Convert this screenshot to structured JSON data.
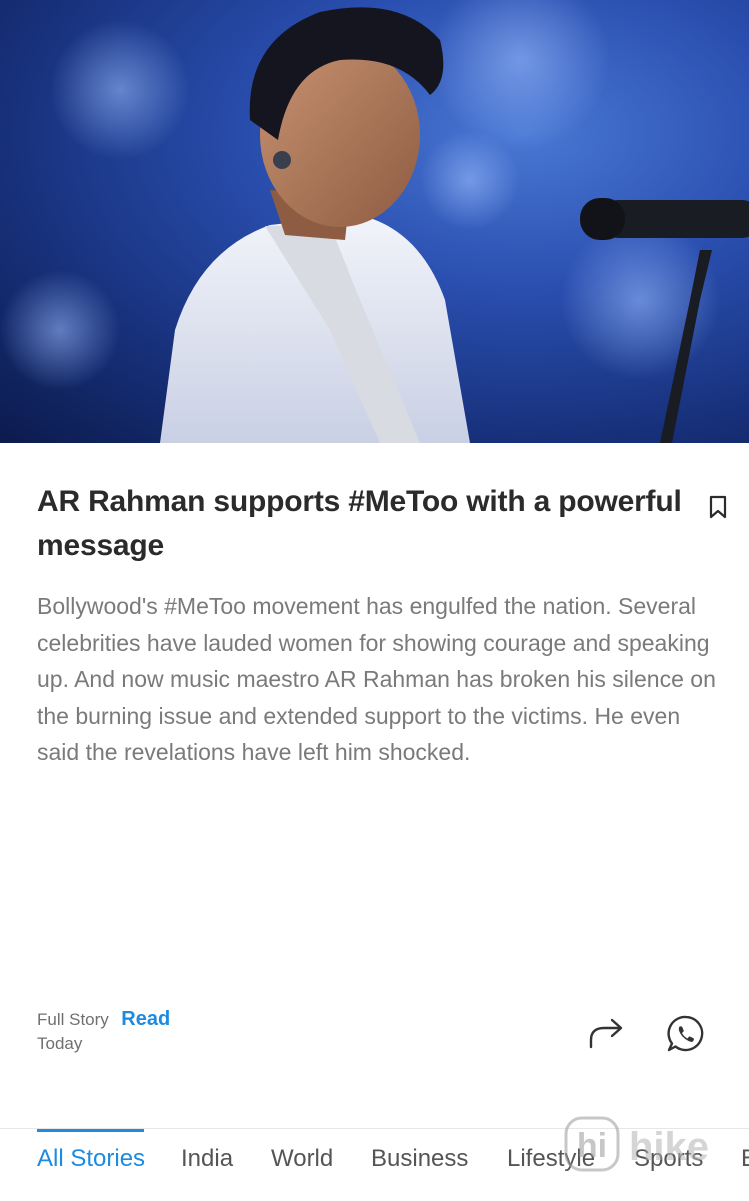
{
  "article": {
    "image_alt": "AR Rahman performing on stage",
    "title": "AR Rahman supports #MeToo with a powerful message",
    "summary": "Bollywood's #MeToo movement has engulfed the nation. Several celebrities have lauded women for showing courage and speaking up. And now music maestro AR Rahman has broken his silence on the burning issue and extended support to the victims. He even said the revelations have left him shocked.",
    "full_story_label": "Full Story",
    "read_label": "Read",
    "date": "Today"
  },
  "icons": {
    "bookmark": "bookmark-icon",
    "share": "share-icon",
    "whatsapp": "whatsapp-icon"
  },
  "tabs": [
    {
      "label": "All Stories",
      "active": true
    },
    {
      "label": "India",
      "active": false
    },
    {
      "label": "World",
      "active": false
    },
    {
      "label": "Business",
      "active": false
    },
    {
      "label": "Lifestyle",
      "active": false
    },
    {
      "label": "Sports",
      "active": false
    },
    {
      "label": "E",
      "active": false
    }
  ],
  "watermark": {
    "text": "hike"
  },
  "colors": {
    "accent": "#1e8be0",
    "title": "#2b2b2b",
    "body_text": "#7a7a7a"
  }
}
